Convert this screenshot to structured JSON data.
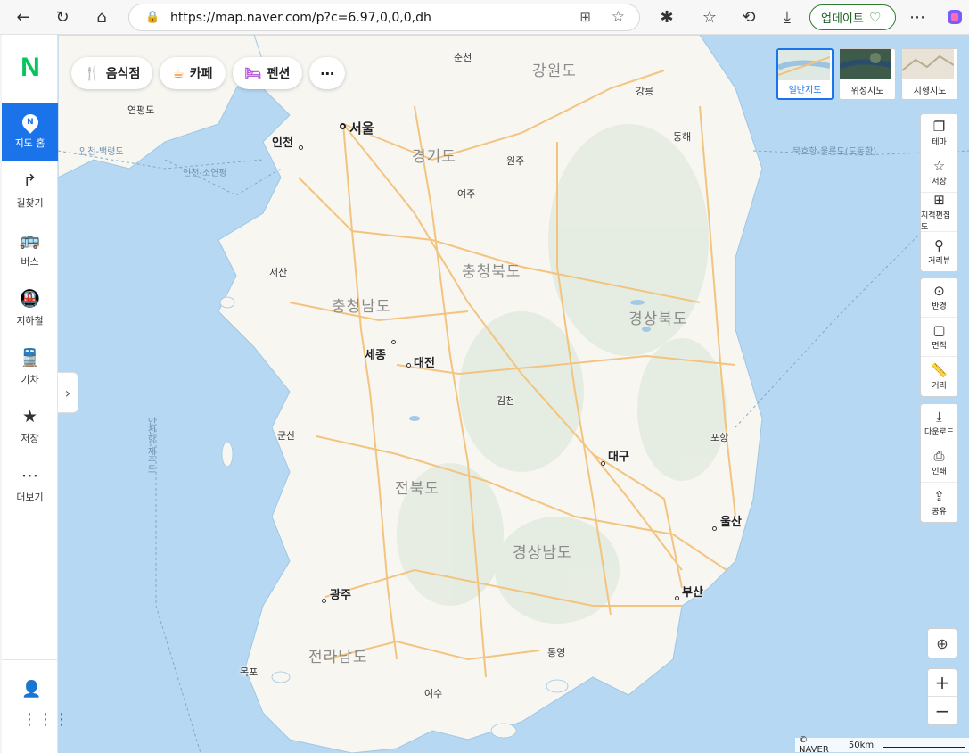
{
  "browser": {
    "url": "https://map.naver.com/p?c=6.97,0,0,0,dh",
    "update_label": "업데이트",
    "icons": [
      "back-icon",
      "refresh-icon",
      "home-icon",
      "lock-icon",
      "split-tabs-icon",
      "favorite-star-icon",
      "extensions-icon",
      "favorites-icon",
      "history-icon",
      "downloads-icon",
      "heart-icon",
      "more-icon",
      "copilot-icon"
    ]
  },
  "sidebar": {
    "logo": "N",
    "items": [
      {
        "label": "지도 홈",
        "icon": "map-pin-icon"
      },
      {
        "label": "길찾기",
        "icon": "directions-icon"
      },
      {
        "label": "버스",
        "icon": "bus-icon"
      },
      {
        "label": "지하철",
        "icon": "subway-icon"
      },
      {
        "label": "기차",
        "icon": "train-icon"
      },
      {
        "label": "저장",
        "icon": "star-icon"
      },
      {
        "label": "더보기",
        "icon": "more-icon"
      }
    ]
  },
  "categories": [
    {
      "label": "음식점",
      "icon": "restaurant-icon",
      "color": "#ff7a00"
    },
    {
      "label": "카페",
      "icon": "cafe-icon",
      "color": "#ff7a00"
    },
    {
      "label": "펜션",
      "icon": "bed-icon",
      "color": "#b455d6"
    }
  ],
  "map_types": [
    {
      "label": "일반지도",
      "selected": true
    },
    {
      "label": "위성지도",
      "selected": false
    },
    {
      "label": "지형지도",
      "selected": false
    }
  ],
  "tools": {
    "group1": [
      {
        "label": "테마",
        "icon": "layers-icon"
      },
      {
        "label": "저장",
        "icon": "star-outline-icon"
      },
      {
        "label": "지적편집도",
        "icon": "cadastral-icon"
      },
      {
        "label": "거리뷰",
        "icon": "street-view-icon"
      }
    ],
    "group2": [
      {
        "label": "반경",
        "icon": "radius-icon"
      },
      {
        "label": "면적",
        "icon": "area-icon"
      },
      {
        "label": "거리",
        "icon": "ruler-icon"
      }
    ],
    "group3": [
      {
        "label": "다운로드",
        "icon": "download-icon"
      },
      {
        "label": "인쇄",
        "icon": "print-icon"
      },
      {
        "label": "공유",
        "icon": "share-icon"
      }
    ]
  },
  "zoom": {
    "in": "+",
    "out": "−"
  },
  "map_labels": {
    "cities": [
      "서울",
      "인천",
      "세종",
      "대전",
      "대구",
      "울산",
      "부산",
      "광주"
    ],
    "towns": [
      "춘천",
      "강릉",
      "동해",
      "원주",
      "여주",
      "서산",
      "김천",
      "군산",
      "포항",
      "통영",
      "목포",
      "여수",
      "연평도"
    ],
    "provinces": [
      "강원도",
      "경기도",
      "충청북도",
      "충청남도",
      "경상북도",
      "전북도",
      "경상남도",
      "전라남도"
    ],
    "routes": [
      "인천-백령도",
      "인천-소연평",
      "묵호항-울릉도(도동항)",
      "인천항-제주도"
    ]
  },
  "footer": {
    "credit": "© NAVER",
    "scale": "50km"
  }
}
